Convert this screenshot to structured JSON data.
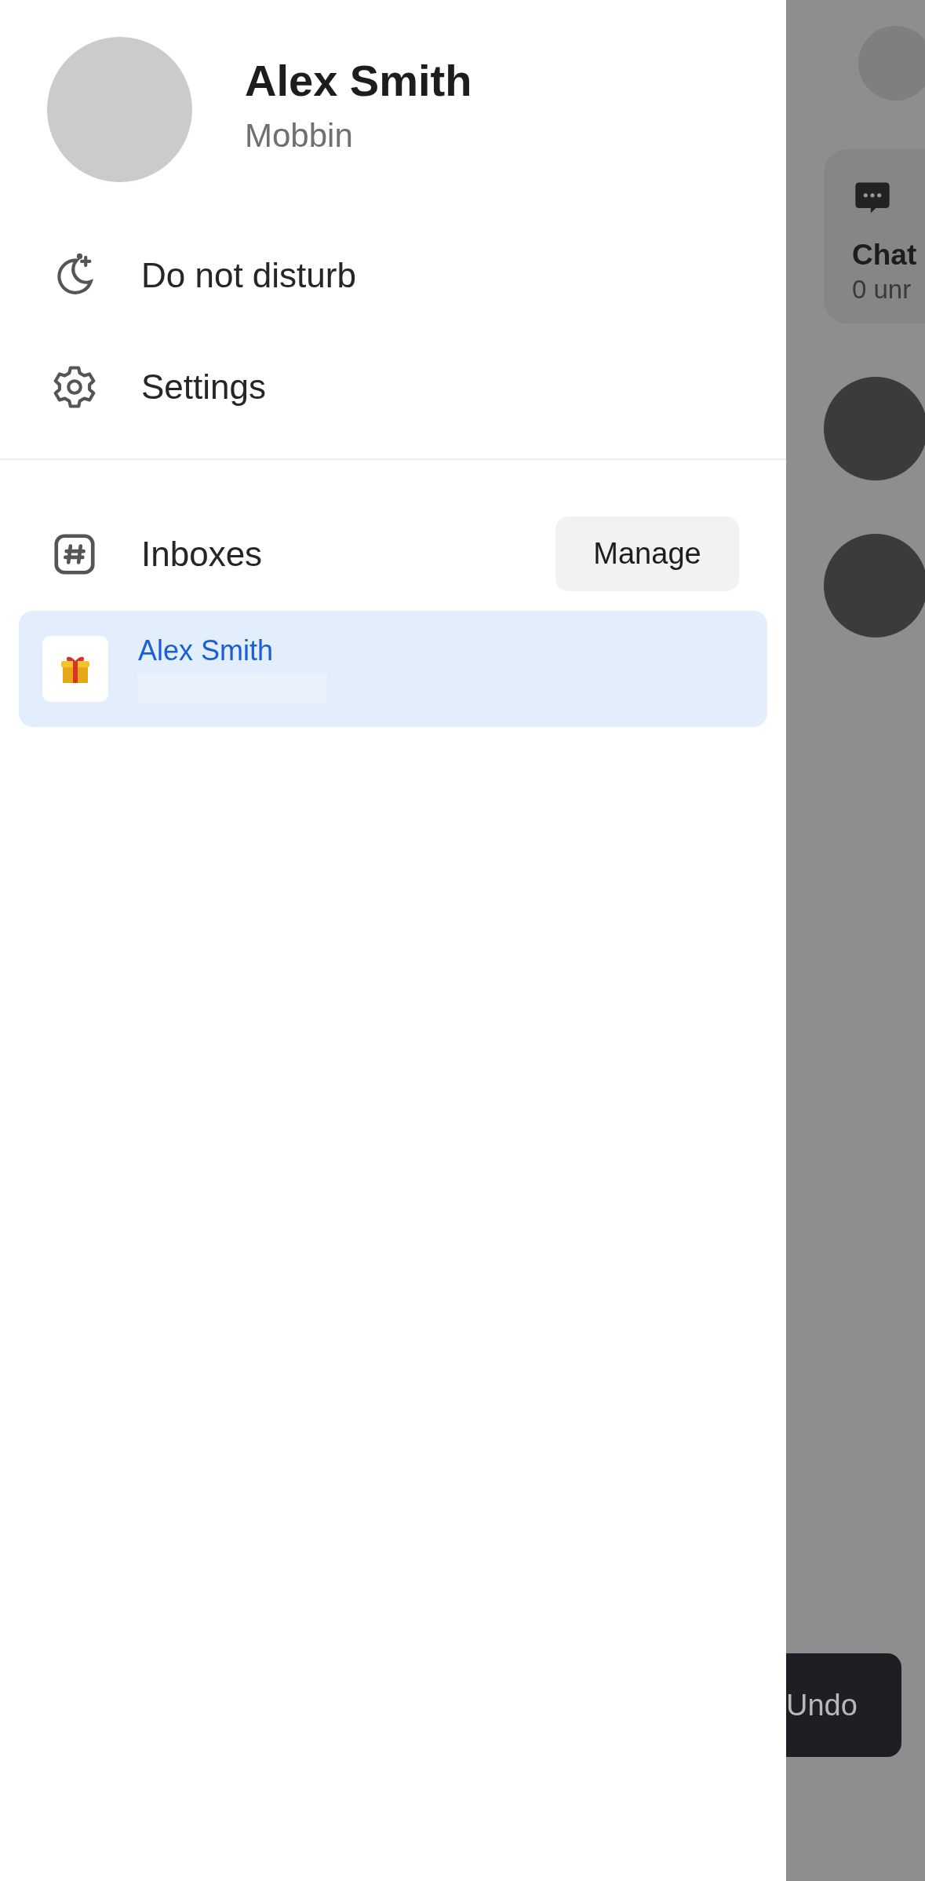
{
  "drawer": {
    "profile": {
      "name": "Alex Smith",
      "organization": "Mobbin"
    },
    "menu": [
      {
        "kind": "moon",
        "label": "Do not disturb"
      },
      {
        "kind": "gear",
        "label": "Settings"
      }
    ],
    "inboxes": {
      "title": "Inboxes",
      "manage_button": "Manage",
      "items": [
        {
          "name": "Alex Smith",
          "selected": true
        }
      ]
    }
  },
  "background_screen": {
    "chats_card": {
      "title": "Chat",
      "subtitle": "0 unr"
    },
    "toast": {
      "action": "Undo"
    }
  }
}
